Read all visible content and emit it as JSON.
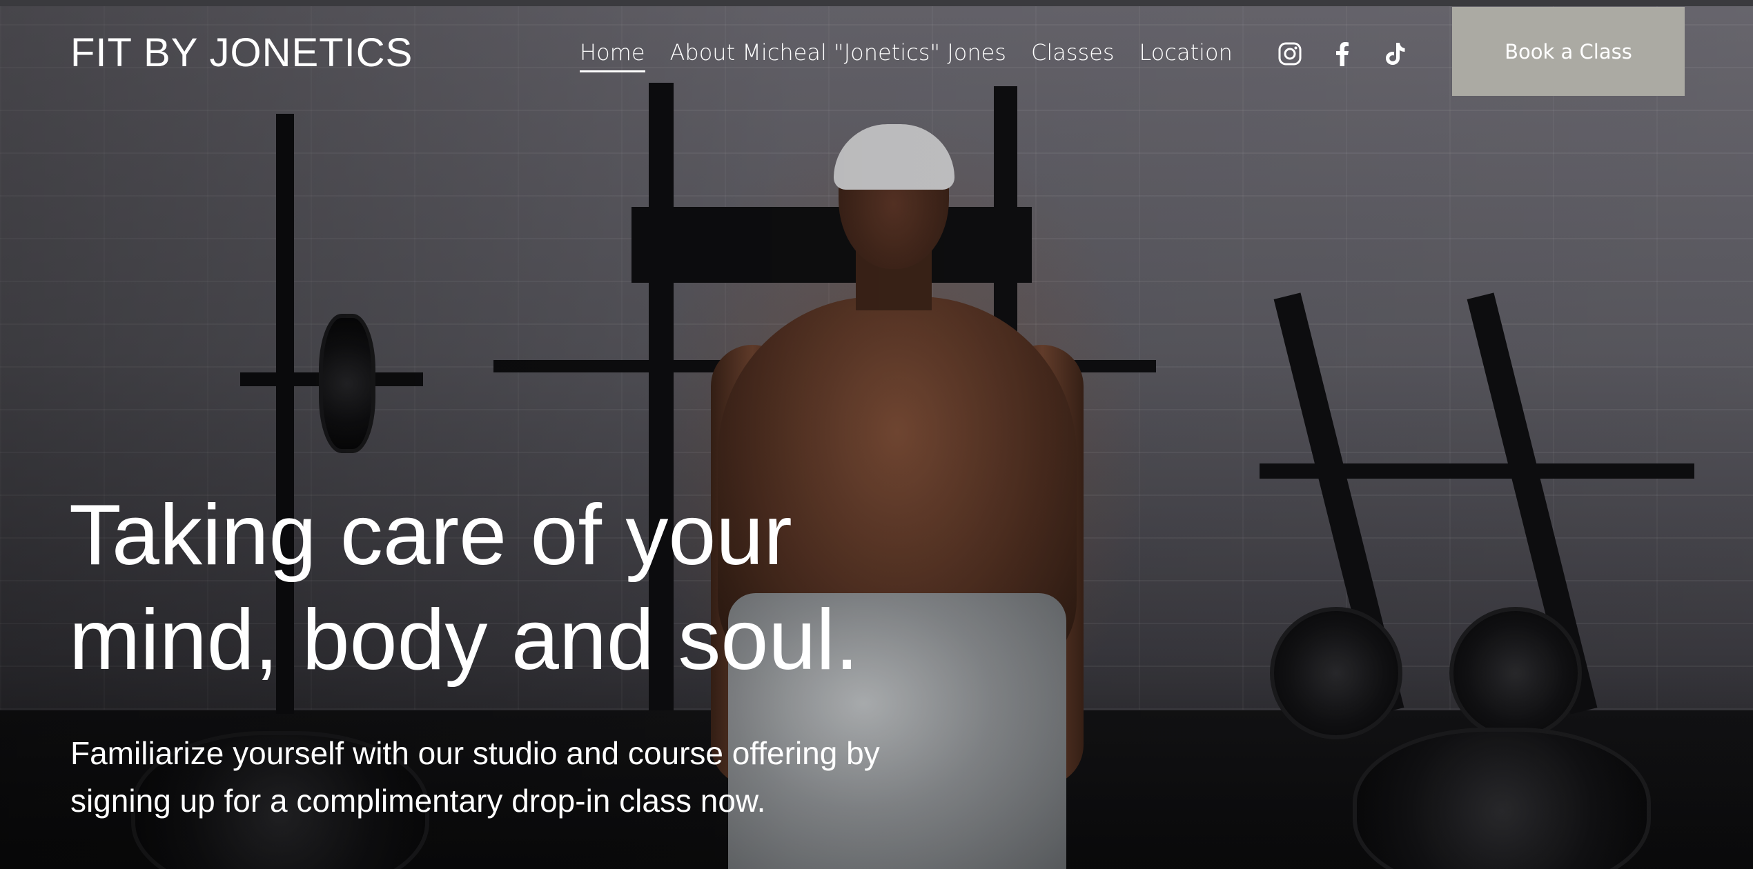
{
  "site": {
    "logo": "FIT BY JONETICS"
  },
  "nav": {
    "items": [
      {
        "label": "Home",
        "active": true
      },
      {
        "label": "About Micheal \"Jonetics\" Jones",
        "active": false
      },
      {
        "label": "Classes",
        "active": false
      },
      {
        "label": "Location",
        "active": false
      }
    ]
  },
  "social": {
    "icons": [
      "instagram-icon",
      "facebook-icon",
      "tiktok-icon"
    ]
  },
  "cta": {
    "label": "Book a Class",
    "color": "#abaaa3"
  },
  "hero": {
    "headline_line1": "Taking care of your",
    "headline_line2": "mind, body and soul.",
    "subtext": "Familiarize yourself with our studio and course offering by signing up for a complimentary drop-in class now."
  }
}
